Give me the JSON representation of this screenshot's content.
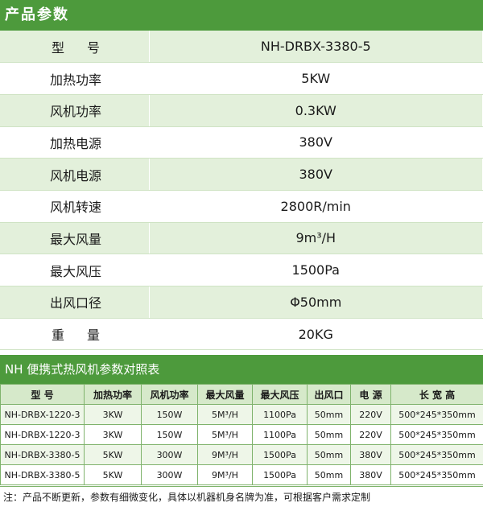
{
  "section1": {
    "title": "产品参数"
  },
  "specs": [
    {
      "label": "型号",
      "value": "NH-DRBX-3380-5"
    },
    {
      "label": "加热功率",
      "value": "5KW"
    },
    {
      "label": "风机功率",
      "value": "0.3KW"
    },
    {
      "label": "加热电源",
      "value": "380V"
    },
    {
      "label": "风机电源",
      "value": "380V"
    },
    {
      "label": "风机转速",
      "value": "2800R/min"
    },
    {
      "label": "最大风量",
      "value": "9m³/H"
    },
    {
      "label": "最大风压",
      "value": "1500Pa"
    },
    {
      "label": "出风口径",
      "value": "Φ50mm"
    },
    {
      "label": "重量",
      "value": "20KG"
    }
  ],
  "section2": {
    "title": "NH 便携式热风机参数对照表"
  },
  "comparison": {
    "headers": [
      "型 号",
      "加热功率",
      "风机功率",
      "最大风量",
      "最大风压",
      "出风口",
      "电 源",
      "长 宽 高"
    ],
    "rows": [
      [
        "NH-DRBX-1220-3",
        "3KW",
        "150W",
        "5M³/H",
        "1100Pa",
        "50mm",
        "220V",
        "500*245*350mm"
      ],
      [
        "NH-DRBX-1220-3",
        "3KW",
        "150W",
        "5M³/H",
        "1100Pa",
        "50mm",
        "220V",
        "500*245*350mm"
      ],
      [
        "NH-DRBX-3380-5",
        "5KW",
        "300W",
        "9M³/H",
        "1500Pa",
        "50mm",
        "380V",
        "500*245*350mm"
      ],
      [
        "NH-DRBX-3380-5",
        "5KW",
        "300W",
        "9M³/H",
        "1500Pa",
        "50mm",
        "380V",
        "500*245*350mm"
      ]
    ]
  },
  "note": "注：产品不断更新，参数有细微变化，具体以机器机身名牌为准，可根据客户需求定制",
  "colors": {
    "header_green": "#4d9a3c",
    "row_tint": "#e3f0db"
  }
}
